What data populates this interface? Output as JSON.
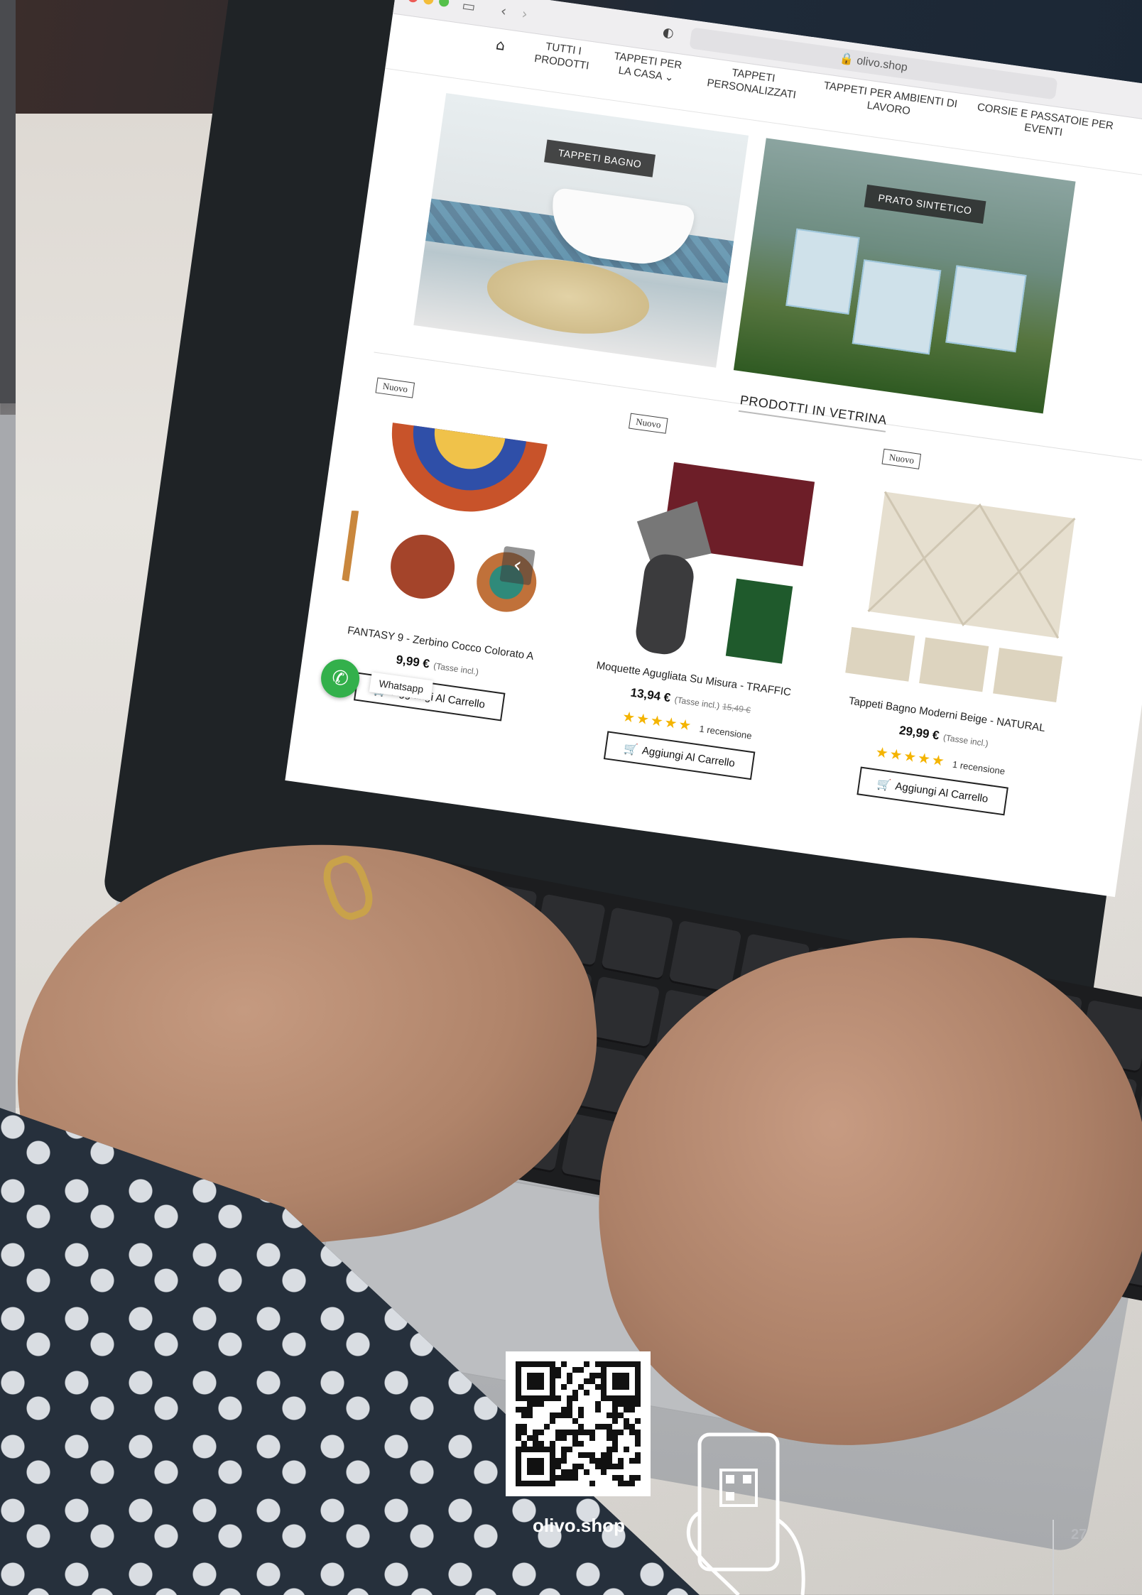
{
  "browser": {
    "url": "olivo.shop"
  },
  "nav": {
    "items": [
      "TUTTI I PRODOTTI",
      "TAPPETI PER LA CASA ⌄",
      "TAPPETI PERSONALIZZATI",
      "TAPPETI PER AMBIENTI DI LAVORO",
      "CORSIE E PASSATOIE PER EVENTI"
    ]
  },
  "banners": [
    {
      "label": "TAPPETI BAGNO"
    },
    {
      "label": "PRATO SINTETICO"
    }
  ],
  "section_title": "PRODOTTI IN VETRINA",
  "products": [
    {
      "badge": "Nuovo",
      "name": "FANTASY 9 - Zerbino Cocco Colorato A",
      "price": "9,99 €",
      "tax": "(Tasse incl.)",
      "old_price": "",
      "stars": "",
      "reviews": "",
      "cart_label": "Aggiungi Al Carrello"
    },
    {
      "badge": "Nuovo",
      "name": "Moquette Agugliata Su Misura - TRAFFIC",
      "price": "13,94 €",
      "tax": "(Tasse incl.)",
      "old_price": "15,49 €",
      "stars": "★★★★★",
      "reviews": "1 recensione",
      "cart_label": "Aggiungi Al Carrello"
    },
    {
      "badge": "Nuovo",
      "name": "Tappeti Bagno Moderni Beige - NATURAL",
      "price": "29,99 €",
      "tax": "(Tasse incl.)",
      "old_price": "",
      "stars": "★★★★★",
      "reviews": "1 recensione",
      "cart_label": "Aggiungi Al Carrello"
    }
  ],
  "whatsapp_label": "Whatsapp",
  "qr_caption": "olivo.shop",
  "page_number": "27",
  "colors": {
    "whatsapp": "#33b04b",
    "stars": "#f4b400"
  }
}
